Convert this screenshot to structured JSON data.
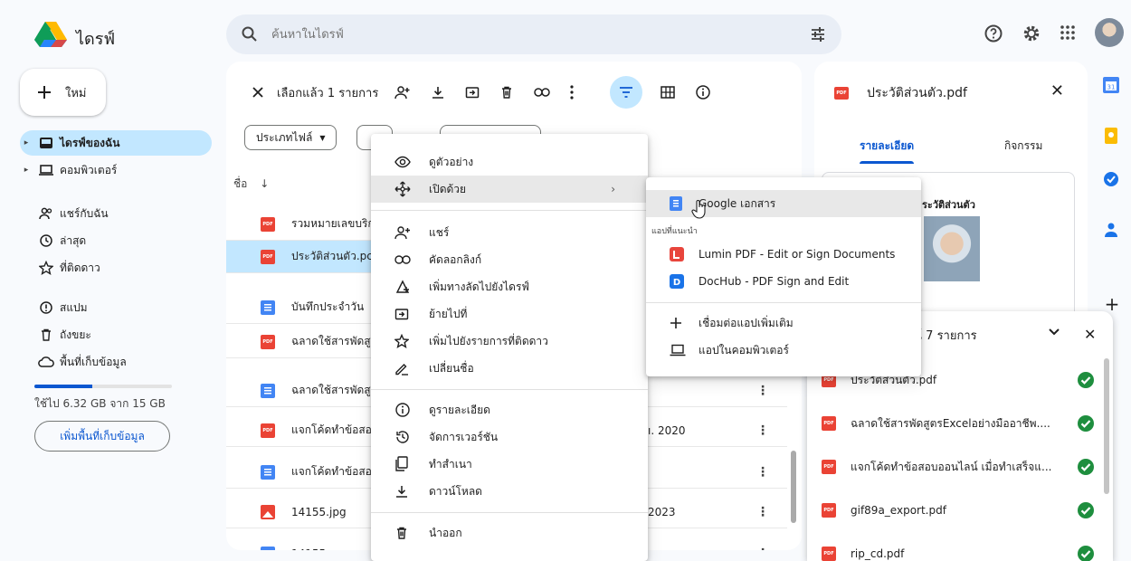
{
  "header": {
    "app_title": "ไดรฟ์",
    "search_placeholder": "ค้นหาในไดรฟ์"
  },
  "sidebar": {
    "new_label": "ใหม่",
    "items": [
      {
        "label": "ไดรฟ์ของฉัน"
      },
      {
        "label": "คอมพิวเตอร์"
      },
      {
        "label": "แชร์กับฉัน"
      },
      {
        "label": "ล่าสุด"
      },
      {
        "label": "ที่ติดดาว"
      },
      {
        "label": "สแปม"
      },
      {
        "label": "ถังขยะ"
      },
      {
        "label": "พื้นที่เก็บข้อมูล"
      }
    ],
    "storage_text": "ใช้ไป 6.32 GB จาก 15 GB",
    "storage_used_fraction": 0.42,
    "more_storage_label": "เพิ่มพื้นที่เก็บข้อมูล"
  },
  "toolbar": {
    "selected_text": "เลือกแล้ว 1 รายการ"
  },
  "filters": {
    "file_type": "ประเภทไฟล์"
  },
  "list": {
    "col_name": "ชื่อ",
    "rows": [
      {
        "name": "รวมหมายเลขบริก",
        "type": "pdf",
        "date": ""
      },
      {
        "name": "ประวัติส่วนตัว.pc",
        "type": "pdf",
        "date": ""
      },
      {
        "name": "บันทึกประจำวัน",
        "type": "doc",
        "date": ""
      },
      {
        "name": "ฉลาดใช้สารพัดสู",
        "type": "pdf",
        "date": ""
      },
      {
        "name": "ฉลาดใช้สารพัดสู",
        "type": "doc",
        "date": ""
      },
      {
        "name": "แจกโค้ดทำข้อสอ",
        "type": "pdf",
        "date": "ı. 2020"
      },
      {
        "name": "แจกโค้ดทำข้อสอ",
        "type": "doc",
        "date": ""
      },
      {
        "name": "14155.jpg",
        "type": "img",
        "date": "2023"
      },
      {
        "name": "14155",
        "type": "doc",
        "date": ""
      }
    ]
  },
  "details": {
    "file_name": "ประวัติส่วนตัว.pdf",
    "tab_details": "รายละเอียด",
    "tab_activity": "กิจกรรม",
    "preview_title": "ระวัติส่วนตัว"
  },
  "uploads": {
    "title": "รณ์ 7 รายการ",
    "items": [
      {
        "name": "ประวัติส่วนตัว.pdf"
      },
      {
        "name": "ฉลาดใช้สารพัดสูตรExcelอย่างมืออาชีพ...."
      },
      {
        "name": "แจกโค้ดทำข้อสอบออนไลน์ เมื่อทำเสร็จแ..."
      },
      {
        "name": "gif89a_export.pdf"
      },
      {
        "name": "rip_cd.pdf"
      }
    ]
  },
  "context_menu": {
    "items": [
      {
        "label": "ดูตัวอย่าง",
        "icon": "eye-icon"
      },
      {
        "label": "เปิดด้วย",
        "icon": "open-with-icon"
      },
      {
        "label": "แชร์",
        "icon": "person-add-icon"
      },
      {
        "label": "คัดลอกลิงก์",
        "icon": "link-icon"
      },
      {
        "label": "เพิ่มทางลัดไปยังไดรฟ์",
        "icon": "add-shortcut-icon"
      },
      {
        "label": "ย้ายไปที่",
        "icon": "move-icon"
      },
      {
        "label": "เพิ่มไปยังรายการที่ติดดาว",
        "icon": "star-icon"
      },
      {
        "label": "เปลี่ยนชื่อ",
        "icon": "rename-icon"
      },
      {
        "label": "ดูรายละเอียด",
        "icon": "info-icon"
      },
      {
        "label": "จัดการเวอร์ชัน",
        "icon": "history-icon"
      },
      {
        "label": "ทำสำเนา",
        "icon": "copy-icon"
      },
      {
        "label": "ดาวน์โหลด",
        "icon": "download-icon"
      },
      {
        "label": "นำออก",
        "icon": "trash-icon"
      }
    ]
  },
  "open_with_menu": {
    "google_docs": "Google เอกสาร",
    "suggested_label": "แอปที่แนะนำ",
    "lumin": "Lumin PDF - Edit or Sign Documents",
    "dochub": "DocHub - PDF Sign and Edit",
    "connect_more": "เชื่อมต่อแอปเพิ่มเติม",
    "computer_apps": "แอปในคอมพิวเตอร์"
  },
  "colors": {
    "accent": "#0b57d0",
    "selected_bg": "#c2e7ff",
    "pdf_red": "#ea4335",
    "doc_blue": "#4285f4",
    "success_green": "#1e8e3e"
  }
}
